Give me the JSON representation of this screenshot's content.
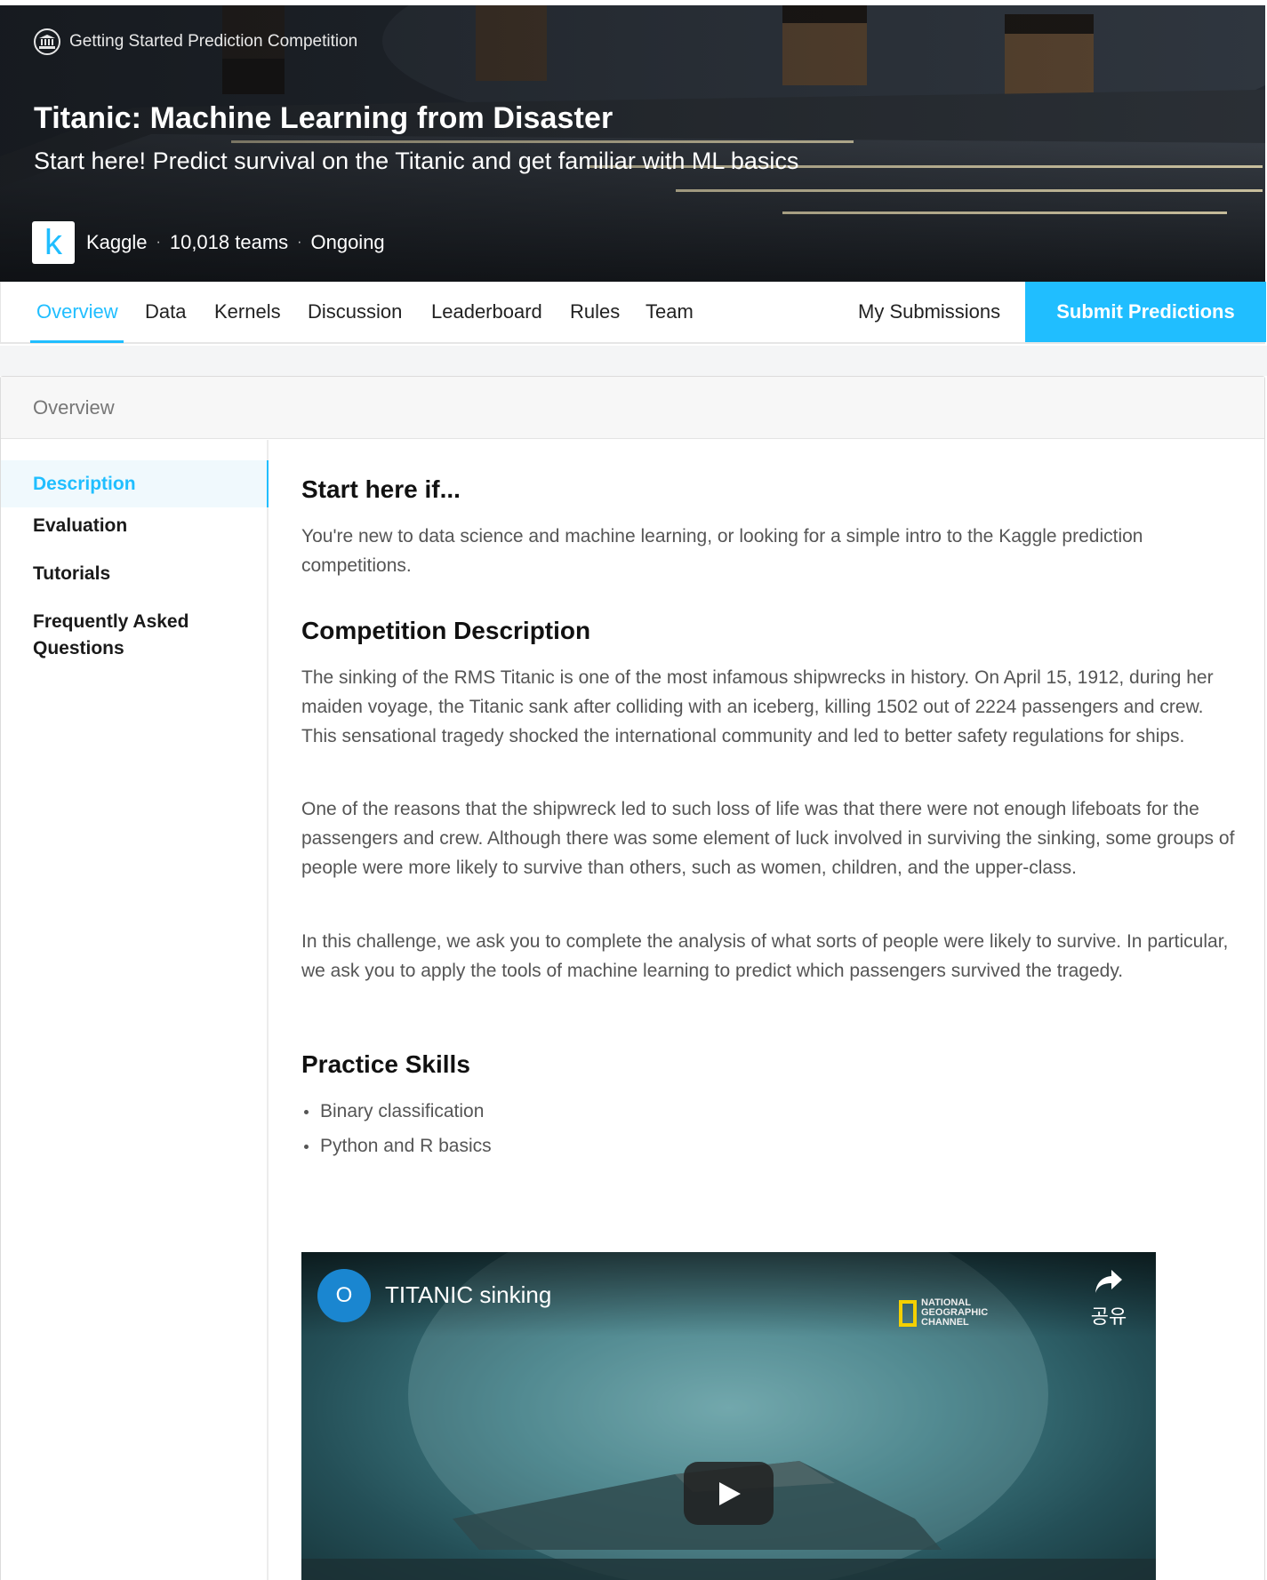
{
  "hero": {
    "kind_label": "Getting Started Prediction Competition",
    "title": "Titanic: Machine Learning from Disaster",
    "subtitle": "Start here! Predict survival on the Titanic and get familiar with ML basics",
    "host_logo_letter": "k",
    "host": "Kaggle",
    "teams": "10,018 teams",
    "status": "Ongoing",
    "separator": "·"
  },
  "tabs": [
    {
      "label": "Overview",
      "active": true
    },
    {
      "label": "Data"
    },
    {
      "label": "Kernels"
    },
    {
      "label": "Discussion"
    },
    {
      "label": "Leaderboard"
    },
    {
      "label": "Rules"
    },
    {
      "label": "Team"
    }
  ],
  "my_submissions": "My Submissions",
  "submit_button": "Submit Predictions",
  "colors": {
    "accent": "#20beff",
    "text_body": "#555555",
    "heading": "#111111"
  },
  "card": {
    "header": "Overview"
  },
  "sidebar": {
    "items": [
      {
        "label": "Description",
        "active": true
      },
      {
        "label": "Evaluation"
      },
      {
        "label": "Tutorials"
      },
      {
        "label": "Frequently Asked Questions"
      }
    ]
  },
  "content": {
    "start_heading": "Start here if...",
    "start_text": "You're new to data science and machine learning, or looking for a simple intro to the Kaggle prediction competitions.",
    "desc_heading": "Competition Description",
    "desc_p1": "The sinking of the RMS Titanic is one of the most infamous shipwrecks in history.  On April 15, 1912, during her maiden voyage, the Titanic sank after colliding with an iceberg, killing 1502 out of 2224 passengers and crew. This sensational tragedy shocked the international community and led to better safety regulations for ships.",
    "desc_p2": "One of the reasons that the shipwreck led to such loss of life was that there were not enough lifeboats for the passengers and crew. Although there was some element of luck involved in surviving the sinking, some groups of people were more likely to survive than others, such as women, children, and the upper-class.",
    "desc_p3": "In this challenge, we ask you to complete the analysis of what sorts of people were likely to survive. In particular, we ask you to apply the tools of machine learning to predict which passengers survived the tragedy.",
    "skills_heading": "Practice Skills",
    "skills": [
      "Binary classification",
      "Python and R basics"
    ]
  },
  "video": {
    "channel_initial": "O",
    "title": "TITANIC sinking",
    "logo_lines": [
      "NATIONAL",
      "GEOGRAPHIC",
      "CHANNEL"
    ],
    "share_label": "공유"
  }
}
